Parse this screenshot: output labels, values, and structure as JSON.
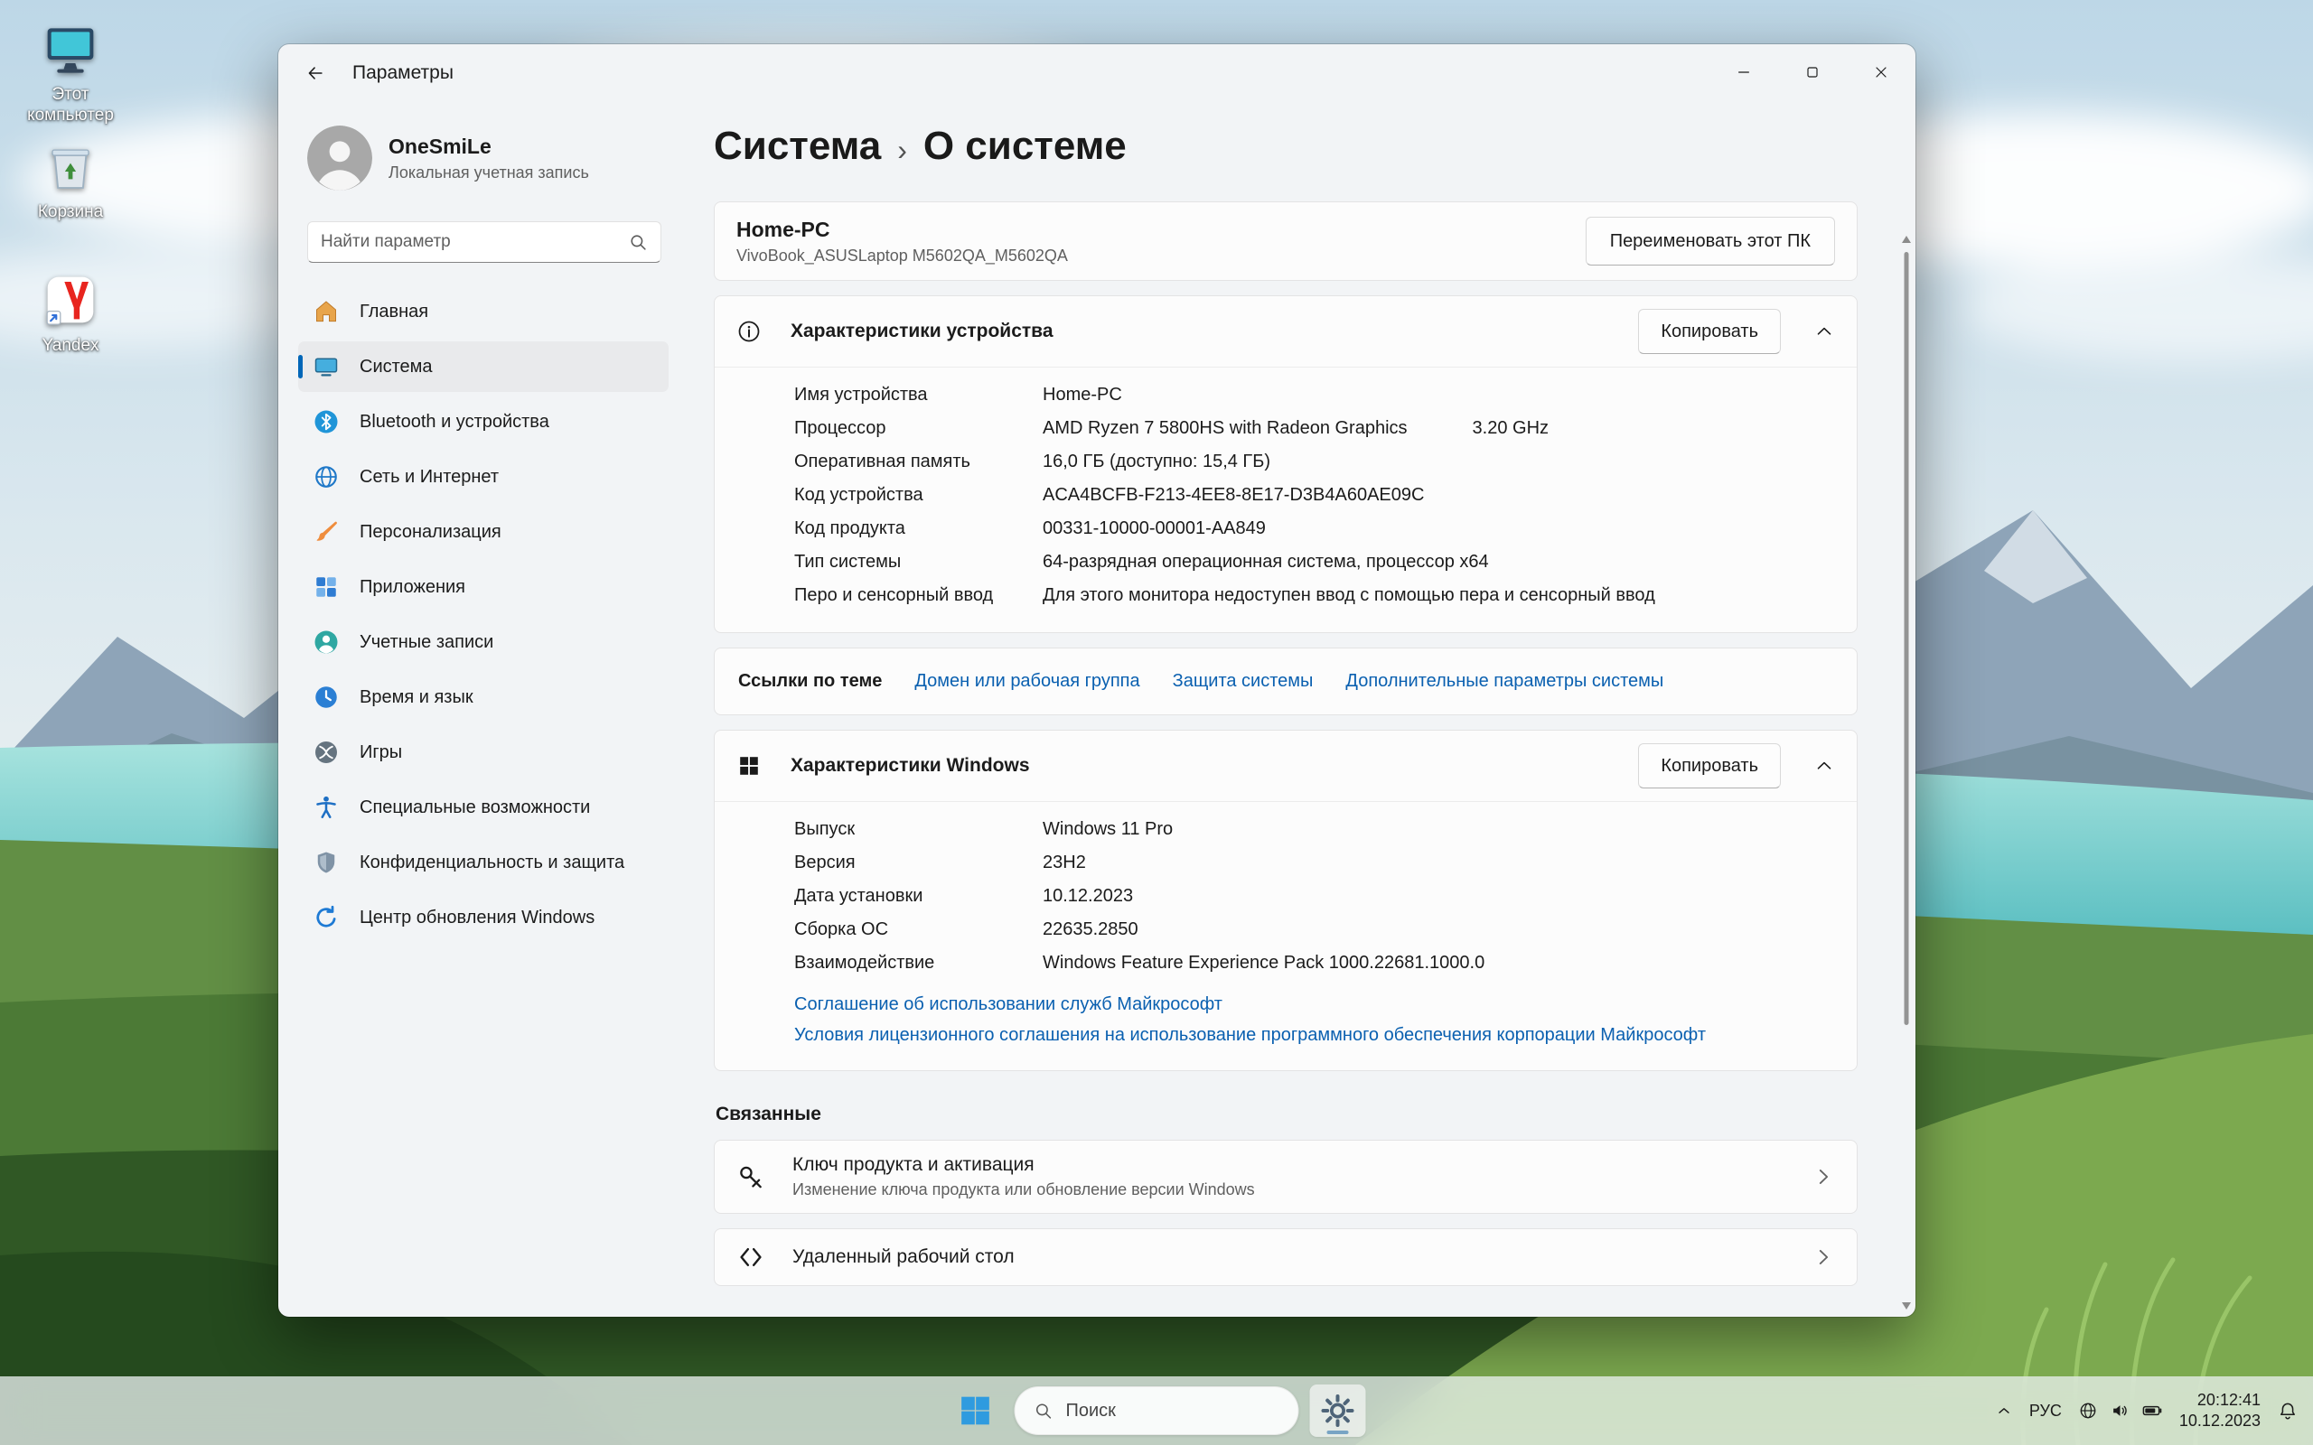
{
  "titlebar": {
    "title": "Параметры"
  },
  "desktop": {
    "icons": [
      {
        "id": "this-pc",
        "label": "Этот компьютер"
      },
      {
        "id": "recycle-bin",
        "label": "Корзина"
      },
      {
        "id": "yandex",
        "label": "Yandex"
      }
    ]
  },
  "sidebar": {
    "user": {
      "name": "OneSmiLe",
      "type": "Локальная учетная запись"
    },
    "search_placeholder": "Найти параметр",
    "items": [
      {
        "label": "Главная",
        "icon": "home",
        "selected": false
      },
      {
        "label": "Система",
        "icon": "system",
        "selected": true
      },
      {
        "label": "Bluetooth и устройства",
        "icon": "bluetooth",
        "selected": false
      },
      {
        "label": "Сеть и Интернет",
        "icon": "network",
        "selected": false
      },
      {
        "label": "Персонализация",
        "icon": "personalization",
        "selected": false
      },
      {
        "label": "Приложения",
        "icon": "apps",
        "selected": false
      },
      {
        "label": "Учетные записи",
        "icon": "accounts",
        "selected": false
      },
      {
        "label": "Время и язык",
        "icon": "time",
        "selected": false
      },
      {
        "label": "Игры",
        "icon": "gaming",
        "selected": false
      },
      {
        "label": "Специальные возможности",
        "icon": "accessibility",
        "selected": false
      },
      {
        "label": "Конфиденциальность и защита",
        "icon": "privacy",
        "selected": false
      },
      {
        "label": "Центр обновления Windows",
        "icon": "update",
        "selected": false
      }
    ]
  },
  "main": {
    "breadcrumb": {
      "parent": "Система",
      "separator": "›",
      "current": "О системе"
    },
    "device_card": {
      "name": "Home-PC",
      "model": "VivoBook_ASUSLaptop M5602QA_M5602QA",
      "rename_button": "Переименовать этот ПК"
    },
    "device_specs": {
      "title": "Характеристики устройства",
      "copy_button": "Копировать",
      "rows": [
        {
          "label": "Имя устройства",
          "value": "Home-PC"
        },
        {
          "label": "Процессор",
          "value": "AMD Ryzen 7 5800HS with Radeon Graphics",
          "extra": "3.20 GHz"
        },
        {
          "label": "Оперативная память",
          "value": "16,0 ГБ (доступно: 15,4 ГБ)"
        },
        {
          "label": "Код устройства",
          "value": "ACA4BCFB-F213-4EE8-8E17-D3B4A60AE09C"
        },
        {
          "label": "Код продукта",
          "value": "00331-10000-00001-AA849"
        },
        {
          "label": "Тип системы",
          "value": "64-разрядная операционная система, процессор x64"
        },
        {
          "label": "Перо и сенсорный ввод",
          "value": "Для этого монитора недоступен ввод с помощью пера и сенсорный ввод"
        }
      ]
    },
    "topic_links": {
      "label": "Ссылки по теме",
      "links": [
        "Домен или рабочая группа",
        "Защита системы",
        "Дополнительные параметры системы"
      ]
    },
    "windows_specs": {
      "title": "Характеристики Windows",
      "copy_button": "Копировать",
      "rows": [
        {
          "label": "Выпуск",
          "value": "Windows 11 Pro"
        },
        {
          "label": "Версия",
          "value": "23H2"
        },
        {
          "label": "Дата установки",
          "value": "10.12.2023"
        },
        {
          "label": "Сборка ОС",
          "value": "22635.2850"
        },
        {
          "label": "Взаимодействие",
          "value": "Windows Feature Experience Pack 1000.22681.1000.0"
        }
      ],
      "links": [
        "Соглашение об использовании служб Майкрософт",
        "Условия лицензионного соглашения на использование программного обеспечения корпорации Майкрософт"
      ]
    },
    "related": {
      "title": "Связанные",
      "items": [
        {
          "title": "Ключ продукта и активация",
          "subtitle": "Изменение ключа продукта или обновление версии Windows",
          "icon": "key"
        },
        {
          "title": "Удаленный рабочий стол",
          "subtitle": "",
          "icon": "remote"
        }
      ]
    }
  },
  "taskbar": {
    "search_placeholder": "Поиск",
    "tray": {
      "language": "РУС",
      "time": "20:12:41",
      "date": "10.12.2023"
    }
  }
}
